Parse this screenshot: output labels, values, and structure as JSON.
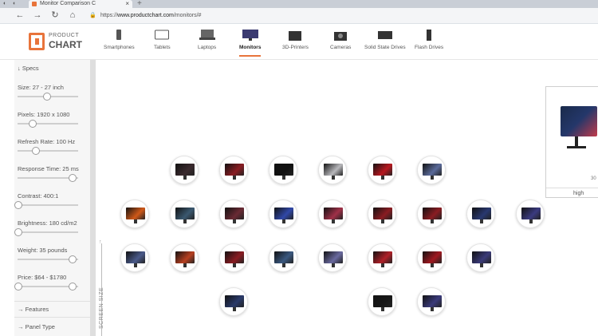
{
  "browser": {
    "tab_title": "Monitor Comparison C",
    "tab_close": "×",
    "new_tab": "+",
    "url_prefix": "https://",
    "url_domain": "www.productchart.com",
    "url_path": "/monitors/#"
  },
  "site": {
    "logo_top": "PRODUCT",
    "logo_bottom": "CHART",
    "categories": [
      {
        "label": "Smartphones",
        "icon": "smartphone-icon",
        "active": false
      },
      {
        "label": "Tablets",
        "icon": "tablet-icon",
        "active": false
      },
      {
        "label": "Laptops",
        "icon": "laptop-icon",
        "active": false
      },
      {
        "label": "Monitors",
        "icon": "monitor-icon",
        "active": true
      },
      {
        "label": "3D-Printers",
        "icon": "printer-icon",
        "active": false
      },
      {
        "label": "Cameras",
        "icon": "camera-icon",
        "active": false
      },
      {
        "label": "Solid State Drives",
        "icon": "ssd-icon",
        "active": false
      },
      {
        "label": "Flash Drives",
        "icon": "flash-drive-icon",
        "active": false
      }
    ],
    "accent_color": "#e8743b"
  },
  "sidebar": {
    "specs_heading": "↓ Specs",
    "filters": [
      {
        "label": "Size: 27 - 27 inch",
        "knobs": [
          0.5
        ]
      },
      {
        "label": "Pixels: 1920 x 1080",
        "knobs": [
          0.25
        ]
      },
      {
        "label": "Refresh Rate: 100 Hz",
        "knobs": [
          0.3
        ]
      },
      {
        "label": "Response Time: 25 ms",
        "knobs": [
          0.95
        ]
      },
      {
        "label": "Contrast: 400:1",
        "knobs": [
          0.0
        ]
      },
      {
        "label": "Brightness: 180 cd/m2",
        "knobs": [
          0.0
        ]
      },
      {
        "label": "Weight: 35 pounds",
        "knobs": [
          0.95
        ]
      },
      {
        "label": "Price: $64 - $1780",
        "knobs": [
          0.0,
          0.95
        ]
      }
    ],
    "features": "→ Features",
    "panel_type": "→ Panel Type"
  },
  "chart": {
    "y_axis_label": "SCREEN SIZE",
    "y_axis_arrow": "↑",
    "products": [
      {
        "row": 0,
        "col": 0,
        "color": "#3a2a2e"
      },
      {
        "row": 0,
        "col": 1,
        "color": "#8a1c22"
      },
      {
        "row": 0,
        "col": 2,
        "color": "#111111"
      },
      {
        "row": 0,
        "col": 3,
        "color": "#b8b8bc"
      },
      {
        "row": 0,
        "col": 4,
        "color": "#b81820"
      },
      {
        "row": 0,
        "col": 5,
        "color": "#5a6a9a"
      },
      {
        "row": 1,
        "col": 0,
        "color": "#d05818"
      },
      {
        "row": 1,
        "col": 1,
        "color": "#3a5870"
      },
      {
        "row": 1,
        "col": 2,
        "color": "#6a2a34"
      },
      {
        "row": 1,
        "col": 3,
        "color": "#3048a8"
      },
      {
        "row": 1,
        "col": 4,
        "color": "#a03048"
      },
      {
        "row": 1,
        "col": 5,
        "color": "#8a1c22"
      },
      {
        "row": 1,
        "col": 6,
        "color": "#8a1c22"
      },
      {
        "row": 1,
        "col": 7,
        "color": "#283870"
      },
      {
        "row": 1,
        "col": 8,
        "color": "#3a3a80"
      },
      {
        "row": 2,
        "col": 0,
        "color": "#4a5a8a"
      },
      {
        "row": 2,
        "col": 1,
        "color": "#b84020"
      },
      {
        "row": 2,
        "col": 2,
        "color": "#8a1c22"
      },
      {
        "row": 2,
        "col": 3,
        "color": "#3a5880"
      },
      {
        "row": 2,
        "col": 4,
        "color": "#6a6aa0"
      },
      {
        "row": 2,
        "col": 5,
        "color": "#b02028"
      },
      {
        "row": 2,
        "col": 6,
        "color": "#a01820"
      },
      {
        "row": 2,
        "col": 7,
        "color": "#3a3a78"
      },
      {
        "row": 3,
        "col": 2,
        "color": "#2a3a6a"
      },
      {
        "row": 3,
        "col": 5,
        "color": "#181818"
      },
      {
        "row": 3,
        "col": 6,
        "color": "#3a3a7a"
      }
    ]
  },
  "detail": {
    "size_text": "30",
    "highlight_text": "high"
  }
}
